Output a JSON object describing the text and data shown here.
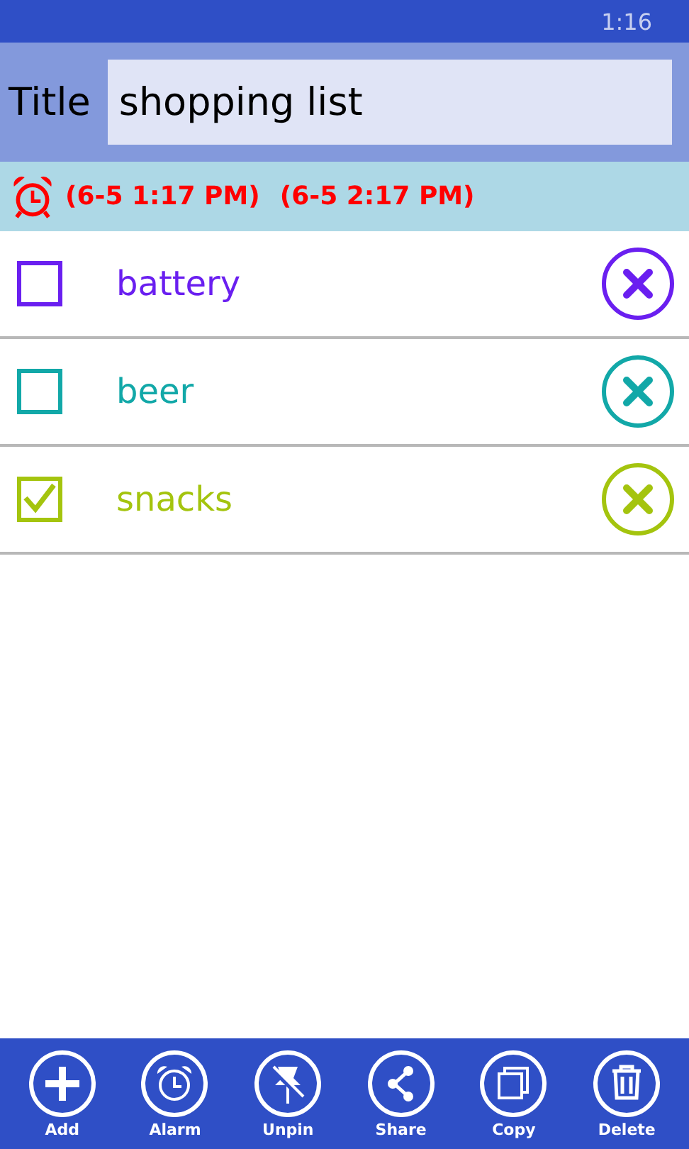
{
  "status_bar": {
    "time": "1:16"
  },
  "header": {
    "label": "Title",
    "value": "shopping list"
  },
  "alarm": {
    "times": [
      "(6-5 1:17 PM)",
      "(6-5 2:17 PM)"
    ]
  },
  "items": [
    {
      "label": "battery",
      "checked": false,
      "color": "#6a1ff0"
    },
    {
      "label": "beer",
      "checked": false,
      "color": "#12a8a8"
    },
    {
      "label": "snacks",
      "checked": true,
      "color": "#a4c40e"
    }
  ],
  "app_bar": [
    {
      "kind": "add",
      "label": "Add"
    },
    {
      "kind": "alarm",
      "label": "Alarm"
    },
    {
      "kind": "unpin",
      "label": "Unpin"
    },
    {
      "kind": "share",
      "label": "Share"
    },
    {
      "kind": "copy",
      "label": "Copy"
    },
    {
      "kind": "delete",
      "label": "Delete"
    }
  ]
}
